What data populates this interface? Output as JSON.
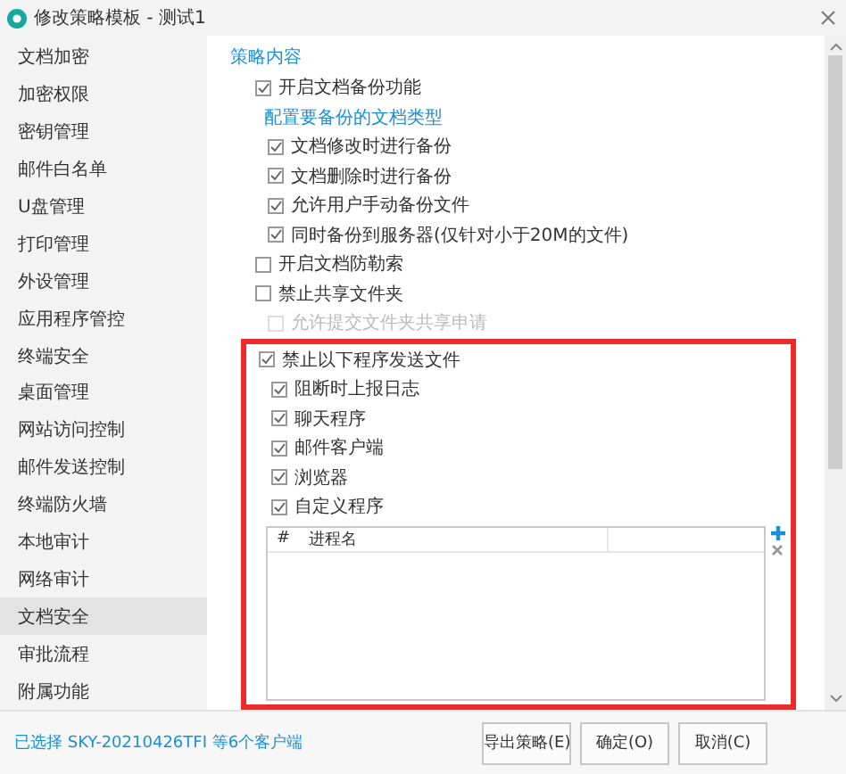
{
  "window": {
    "title": "修改策略模板 - 测试1"
  },
  "sidebar": {
    "items": [
      {
        "label": "文档加密",
        "selected": false
      },
      {
        "label": "加密权限",
        "selected": false
      },
      {
        "label": "密钥管理",
        "selected": false
      },
      {
        "label": "邮件白名单",
        "selected": false
      },
      {
        "label": "U盘管理",
        "selected": false
      },
      {
        "label": "打印管理",
        "selected": false
      },
      {
        "label": "外设管理",
        "selected": false
      },
      {
        "label": "应用程序管控",
        "selected": false
      },
      {
        "label": "终端安全",
        "selected": false
      },
      {
        "label": "桌面管理",
        "selected": false
      },
      {
        "label": "网站访问控制",
        "selected": false
      },
      {
        "label": "邮件发送控制",
        "selected": false
      },
      {
        "label": "终端防火墙",
        "selected": false
      },
      {
        "label": "本地审计",
        "selected": false
      },
      {
        "label": "网络审计",
        "selected": false
      },
      {
        "label": "文档安全",
        "selected": true
      },
      {
        "label": "审批流程",
        "selected": false
      },
      {
        "label": "附属功能",
        "selected": false
      }
    ]
  },
  "content": {
    "heading": "策略内容",
    "options": [
      {
        "kind": "checkbox",
        "label": "开启文档备份功能",
        "checked": true,
        "children": [
          {
            "kind": "link",
            "label": "配置要备份的文档类型"
          },
          {
            "kind": "checkbox",
            "label": "文档修改时进行备份",
            "checked": true
          },
          {
            "kind": "checkbox",
            "label": "文档删除时进行备份",
            "checked": true
          },
          {
            "kind": "checkbox",
            "label": "允许用户手动备份文件",
            "checked": true
          },
          {
            "kind": "checkbox",
            "label": "同时备份到服务器(仅针对小于20M的文件)",
            "checked": true
          }
        ]
      },
      {
        "kind": "checkbox",
        "label": "开启文档防勒索",
        "checked": false
      },
      {
        "kind": "checkbox",
        "label": "禁止共享文件夹",
        "checked": false,
        "children": [
          {
            "kind": "checkbox",
            "label": "允许提交文件夹共享申请",
            "checked": false,
            "disabled": true
          }
        ]
      },
      {
        "kind": "checkbox",
        "label": "禁止以下程序发送文件",
        "checked": true,
        "highlighted": true,
        "children": [
          {
            "kind": "checkbox",
            "label": "阻断时上报日志",
            "checked": true
          },
          {
            "kind": "checkbox",
            "label": "聊天程序",
            "checked": true
          },
          {
            "kind": "checkbox",
            "label": "邮件客户端",
            "checked": true
          },
          {
            "kind": "checkbox",
            "label": "浏览器",
            "checked": true
          },
          {
            "kind": "checkbox",
            "label": "自定义程序",
            "checked": true
          }
        ],
        "table": {
          "columns": [
            "#",
            "进程名"
          ]
        }
      }
    ]
  },
  "status": "已选择 SKY-20210426TFI 等6个客户端",
  "buttons": [
    "导出策略(E)",
    "确定(O)",
    "取消(C)"
  ]
}
